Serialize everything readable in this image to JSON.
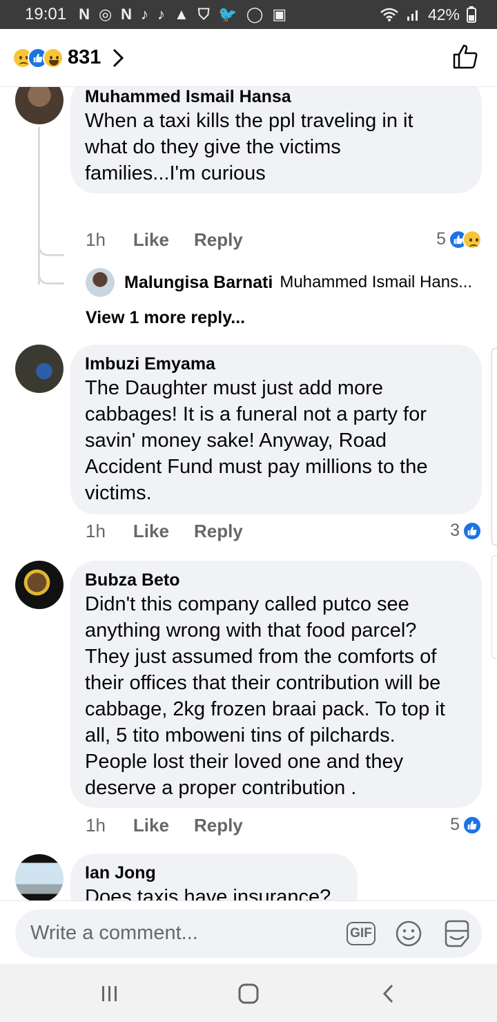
{
  "status_bar": {
    "time": "19:01",
    "notification_icons": [
      "N",
      "◎",
      "N",
      "♪",
      "♪",
      "▲",
      "⛉",
      "🐦",
      "◯",
      "▣"
    ],
    "battery": "42%"
  },
  "header": {
    "reaction_icons": [
      "sad-emoji",
      "like-emoji",
      "haha-emoji"
    ],
    "reaction_count": "831"
  },
  "comments": [
    {
      "name": "Muhammed Ismail Hansa",
      "text": [
        "When a taxi kills the ppl traveling in it",
        "what do they give the victims",
        "families...I'm curious"
      ],
      "time": "1h",
      "like_label": "Like",
      "reply_label": "Reply",
      "reactions_count": "5",
      "reply_preview": {
        "name": "Malungisa Barnati",
        "text": "Muhammed Ismail Hans..."
      },
      "view_more": "View 1 more reply..."
    },
    {
      "name": "Imbuzi Emyama",
      "text": [
        "The Daughter must just add more",
        "cabbages! It is a funeral not a party for",
        "savin' money sake! Anyway, Road",
        "Accident Fund must pay millions to the",
        "victims."
      ],
      "time": "1h",
      "like_label": "Like",
      "reply_label": "Reply",
      "reactions_count": "3"
    },
    {
      "name": "Bubza Beto",
      "text": [
        "Didn't this company called putco see",
        "anything wrong with that food parcel?",
        "They just assumed from the comforts of",
        "their offices that their contribution will be",
        "cabbage, 2kg frozen braai pack. To top it",
        "all, 5 tito mboweni tins of pilchards.",
        "People lost their loved one and they",
        "deserve a proper contribution  ."
      ],
      "time": "1h",
      "like_label": "Like",
      "reply_label": "Reply",
      "reactions_count": "5"
    },
    {
      "name": "Ian Jong",
      "text": [
        "Does taxis have insurance?"
      ]
    }
  ],
  "composer": {
    "placeholder": "Write a comment...",
    "gif_label": "GIF"
  },
  "colors": {
    "accent": "#1b74e4",
    "bubble": "#f0f2f5",
    "status_bar": "#3b3b3b"
  }
}
